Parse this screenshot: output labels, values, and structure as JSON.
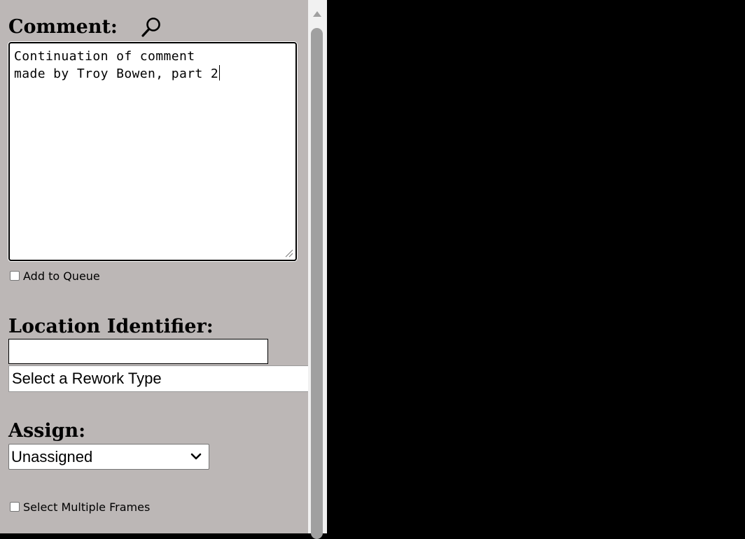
{
  "comment": {
    "heading": "Comment:",
    "search_icon": "magnifier-icon",
    "text": "Continuation of comment\nmade by Troy Bowen, part 2"
  },
  "queue": {
    "label": "Add to Queue",
    "checked": false
  },
  "location": {
    "heading": "Location Identifier:",
    "value": ""
  },
  "rework": {
    "selected": "Select a Rework Type"
  },
  "assign": {
    "heading": "Assign:",
    "selected": "Unassigned",
    "chevron_icon": "chevron-down-icon"
  },
  "multiple_frames": {
    "label": "Select Multiple Frames",
    "checked": false
  },
  "colors": {
    "panel_bg": "#bcb7b6",
    "viewer_bg": "#000000",
    "scrollbar_thumb": "#a0a0a0"
  }
}
